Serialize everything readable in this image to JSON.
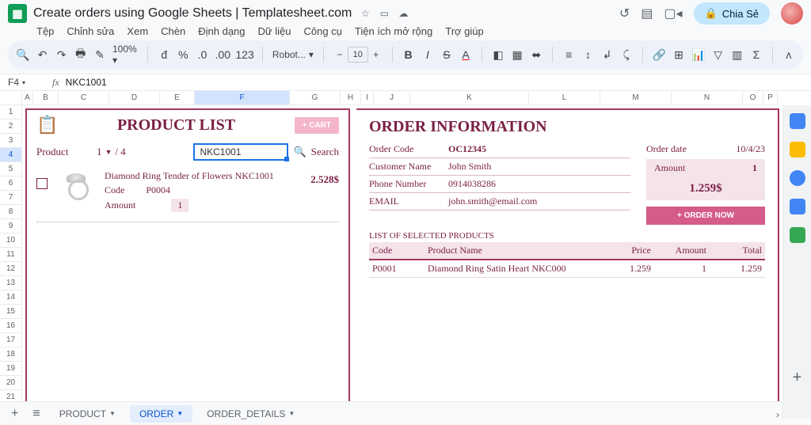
{
  "doc": {
    "title": "Create orders using Google Sheets | Templatesheet.com"
  },
  "share": {
    "label": "Chia Sẻ"
  },
  "menus": [
    "Tệp",
    "Chỉnh sửa",
    "Xem",
    "Chèn",
    "Định dạng",
    "Dữ liệu",
    "Công cụ",
    "Tiện ích mở rộng",
    "Trợ giúp"
  ],
  "toolbar": {
    "zoom": "100%",
    "currency": "đ",
    "pct": "%",
    "dec_dec": ".0",
    "dec_inc": ".00",
    "numfmt": "123",
    "font": "Robot...",
    "fontsize": "10"
  },
  "namebox": "F4",
  "formula": "NKC1001",
  "cols": {
    "A": 14,
    "B": 32,
    "C": 60,
    "D": 60,
    "E": 40,
    "F": 120,
    "G": 60,
    "H": 30,
    "I": 20,
    "J": 46,
    "K": 150,
    "L": 90,
    "M": 90,
    "N": 90,
    "O": 30,
    "P": 20
  },
  "productList": {
    "title": "PRODUCT LIST",
    "cartBtn": "+ CART",
    "productLbl": "Product",
    "page": "1",
    "pagerSep": "/ 4",
    "searchValue": "NKC1001",
    "searchLbl": "Search",
    "item": {
      "name": "Diamond Ring Tender of Flowers NKC1001",
      "codeLbl": "Code",
      "code": "P0004",
      "amountLbl": "Amount",
      "amount": "1",
      "price": "2.528$"
    }
  },
  "orderInfo": {
    "title": "ORDER INFORMATION",
    "orderCodeLbl": "Order Code",
    "orderCode": "OC12345",
    "orderDateLbl": "Order date",
    "orderDate": "10/4/23",
    "custNameLbl": "Customer Name",
    "custName": "John Smith",
    "phoneLbl": "Phone Number",
    "phone": "0914038286",
    "emailLbl": "EMAIL",
    "email": "john.smith@email.com",
    "amountLbl": "Amount",
    "amount": "1",
    "total": "1.259$",
    "orderBtn": "+ ORDER NOW",
    "listTitle": "LIST OF SELECTED PRODUCTS",
    "headers": {
      "code": "Code",
      "name": "Product Name",
      "price": "Price",
      "amount": "Amount",
      "total": "Total"
    },
    "row": {
      "code": "P0001",
      "name": "Diamond Ring Satin Heart NKC000",
      "price": "1.259",
      "amount": "1",
      "total": "1.259"
    }
  },
  "tabs": {
    "product": "PRODUCT",
    "order": "ORDER",
    "details": "ORDER_DETAILS"
  }
}
